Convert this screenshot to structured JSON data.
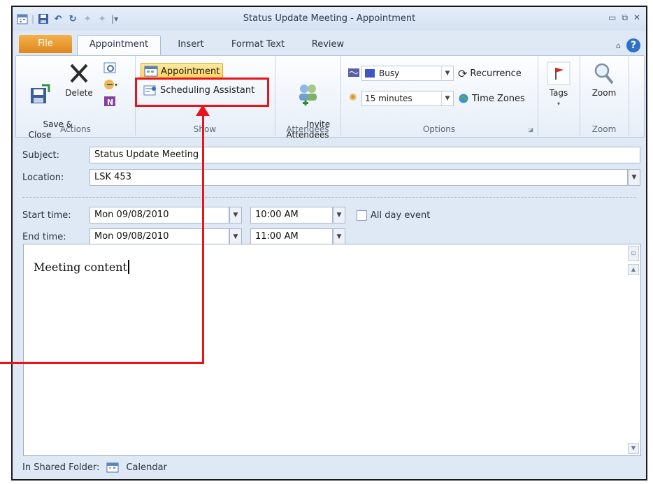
{
  "window": {
    "title": "Status Update Meeting  -  Appointment",
    "controls": [
      "minimize",
      "restore",
      "close"
    ]
  },
  "tabs": [
    {
      "label": "File"
    },
    {
      "label": "Appointment"
    },
    {
      "label": "Insert"
    },
    {
      "label": "Format Text"
    },
    {
      "label": "Review"
    }
  ],
  "ribbon": {
    "actions": {
      "group_label": "Actions",
      "save_close": "Save &\nClose",
      "delete": "Delete"
    },
    "show": {
      "group_label": "Show",
      "appointment": "Appointment",
      "scheduling": "Scheduling Assistant"
    },
    "attendees": {
      "group_label": "Attendees",
      "invite": "Invite\nAttendees"
    },
    "options": {
      "group_label": "Options",
      "show_as": "Busy",
      "reminder": "15 minutes",
      "recurrence": "Recurrence",
      "time_zones": "Time Zones"
    },
    "tags": {
      "label": "Tags"
    },
    "zoom": {
      "group_label": "Zoom",
      "label": "Zoom"
    }
  },
  "form": {
    "subject_label": "Subject:",
    "subject_value": "Status Update Meeting",
    "location_label": "Location:",
    "location_value": "LSK 453",
    "start_label": "Start time:",
    "start_date": "Mon 09/08/2010",
    "start_time": "10:00 AM",
    "end_label": "End time:",
    "end_date": "Mon 09/08/2010",
    "end_time": "11:00 AM",
    "all_day_label": "All day event"
  },
  "body": {
    "content": "Meeting content"
  },
  "status": {
    "folder_label": "In Shared Folder:",
    "folder_name": "Calendar"
  },
  "colors": {
    "accent_file_tab": "#e1861e",
    "highlight_red": "#e8141a",
    "button_highlight": "#fbd25c"
  }
}
